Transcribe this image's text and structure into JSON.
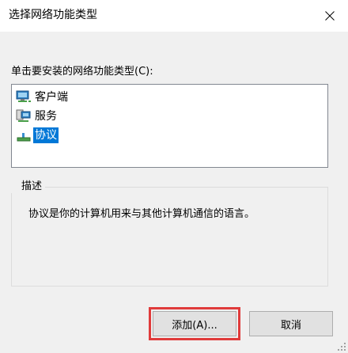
{
  "window": {
    "title": "选择网络功能类型"
  },
  "titlebar": {
    "close_icon": "close-icon"
  },
  "prompt": {
    "label": "单击要安装的网络功能类型(C):"
  },
  "feature_list": {
    "items": [
      {
        "label": "客户端",
        "icon": "network-client-icon",
        "selected": false
      },
      {
        "label": "服务",
        "icon": "network-service-icon",
        "selected": false
      },
      {
        "label": "协议",
        "icon": "network-protocol-icon",
        "selected": true
      }
    ]
  },
  "description": {
    "legend": "描述",
    "text": "协议是你的计算机用来与其他计算机通信的语言。"
  },
  "buttons": {
    "add_label": "添加(A)...",
    "cancel_label": "取消"
  },
  "colors": {
    "selection": "#0078d7",
    "highlight_outline": "#e03b3b",
    "window_bg": "#f0f0f0"
  }
}
